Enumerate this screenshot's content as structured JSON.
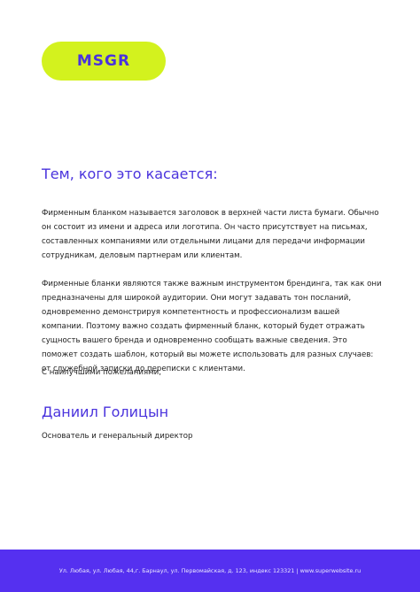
{
  "header": {
    "logo_text": "MSGR"
  },
  "letter": {
    "salutation": "Тем, кого это касается:",
    "paragraphs": [
      "Фирменным бланком называется заголовок в верхней части листа бумаги. Обычно он состоит из имени и адреса или логотипа. Он часто присутствует на письмах, составленных компаниями или отдельными лицами для передачи информации сотрудникам, деловым партнерам или клиентам.",
      "Фирменные бланки являются также важным инструментом брендинга, так как они предназначены для широкой аудитории. Они могут задавать тон посланий, одновременно демонстрируя компетентность и профессионализм вашей компании. Поэтому важно создать фирменный бланк, который будет отражать сущность вашего бренда и одновременно сообщать важные сведения. Это поможет создать шаблон, который вы можете использовать для разных случаев: от служебной записки до переписки с клиентами."
    ],
    "closing": "С наилучшими пожеланиями,",
    "signer_name": "Даниил Голицын",
    "signer_title": "Основатель и генеральный директор"
  },
  "footer": {
    "text": "Ул. Любая, ул. Любая, 44,г. Барнаул, ул. Первомайская, д. 123, индекс 123321 | www.superwebsite.ru"
  },
  "colors": {
    "accent_purple": "#4a33dd",
    "logo_lime": "#d3f21e",
    "footer_purple": "#5530f0"
  }
}
